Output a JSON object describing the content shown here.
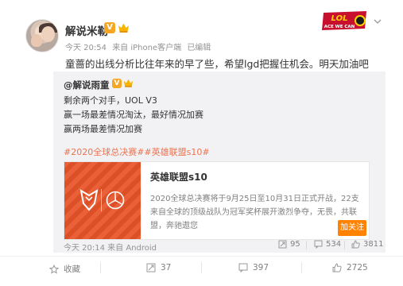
{
  "post": {
    "author": "解说米勒",
    "verified_badge": "V",
    "timestamp": "今天 20:54",
    "source": "来自 iPhone客户端",
    "edited": "已编辑",
    "brand_text_top": "LOL",
    "brand_text_bottom": "ACE WE CAN",
    "content": "童蔷的出线分析比往年来的早了些，希望lgd把握住机会。明天加油吧"
  },
  "repost": {
    "author": "@解说雨童",
    "verified_badge": "V",
    "lines": [
      "剩余两个对手，UOL V3",
      "赢一场最差情况淘汰，最好情况加赛",
      "赢两场最差情况加赛"
    ],
    "tags": "#2020全球总决赛##英雄联盟s10#",
    "card": {
      "title": "英雄联盟s10",
      "description": "2020全球总决赛将于9月25日至10月31日正式开战，22支来自全球的顶级战队为冠军奖杯展开激烈争夺，无畏，共联盟，奔驰遨您",
      "follow_label": "加关注"
    },
    "footer": {
      "time_source": "今天 20:14 来自 Android",
      "reposts": "95",
      "comments": "534",
      "likes": "3811"
    }
  },
  "actions": {
    "favorite": "收藏",
    "repost": "37",
    "comment": "397",
    "like": "2725"
  },
  "colors": {
    "accent_orange": "#ff8200",
    "tag_color": "#eb7350",
    "card_image": "#e8542a",
    "repost_bg": "#f2f2f5"
  }
}
